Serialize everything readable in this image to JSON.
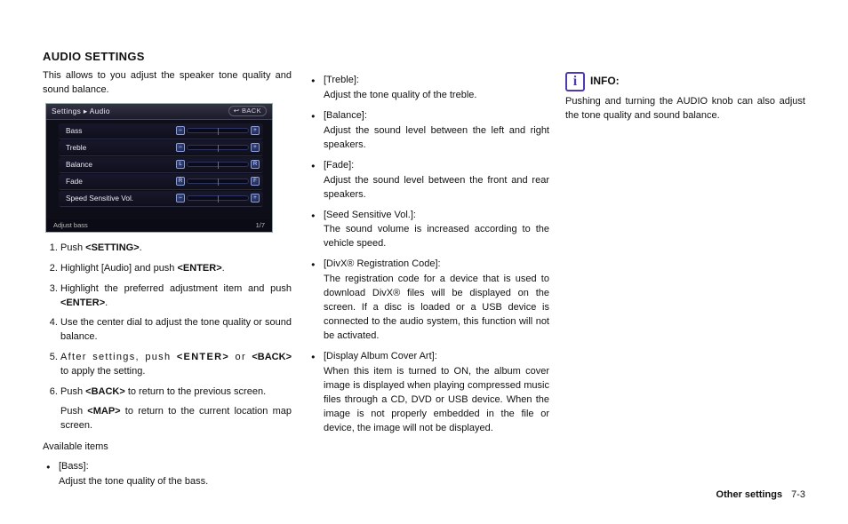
{
  "heading": "AUDIO SETTINGS",
  "intro": "This allows to you adjust the speaker tone quality and sound balance.",
  "screenshot": {
    "breadcrumb": "Settings ▸ Audio",
    "back": "↩ BACK",
    "rows": [
      {
        "label": "Bass",
        "left": "–",
        "right": "+"
      },
      {
        "label": "Treble",
        "left": "–",
        "right": "+"
      },
      {
        "label": "Balance",
        "left": "L",
        "right": "R"
      },
      {
        "label": "Fade",
        "left": "R",
        "right": "F"
      },
      {
        "label": "Speed Sensitive Vol.",
        "left": "–",
        "right": "+"
      }
    ],
    "status": "Adjust bass",
    "page": "1/7"
  },
  "steps": [
    {
      "pre": "Push ",
      "kw": "<SETTING>",
      "post": "."
    },
    {
      "pre": "Highlight [Audio] and push ",
      "kw": "<ENTER>",
      "post": "."
    },
    {
      "pre": "Highlight the preferred adjustment item and push ",
      "kw": "<ENTER>",
      "post": "."
    },
    {
      "pre": "Use the center dial to adjust the tone quality or sound balance.",
      "kw": "",
      "post": ""
    },
    {
      "raw_html": true,
      "text_a": "After settings, push ",
      "kw_a": "<ENTER>",
      "mid": " or ",
      "kw_b": "<BACK>",
      "text_b": " to apply the setting.",
      "wide": true
    },
    {
      "pre": "Push ",
      "kw": "<BACK>",
      "post": " to return to the previous screen.",
      "sub_pre": "Push ",
      "sub_kw": "<MAP>",
      "sub_post": " to return to the current location map screen."
    }
  ],
  "available_label": "Available items",
  "col1_item": {
    "label": "[Bass]:",
    "desc": "Adjust the tone quality of the bass."
  },
  "col2_items": [
    {
      "label": "[Treble]:",
      "desc": "Adjust the tone quality of the treble."
    },
    {
      "label": "[Balance]:",
      "desc": "Adjust the sound level between the left and right speakers."
    },
    {
      "label": "[Fade]:",
      "desc": "Adjust the sound level between the front and rear speakers."
    },
    {
      "label": "[Seed Sensitive Vol.]:",
      "desc": "The sound volume is increased according to the vehicle speed."
    },
    {
      "label": "[DivX® Registration Code]:",
      "desc": "The registration code for a device that is used to download DivX® files will be displayed on the screen. If a disc is loaded or a USB device is connected to the audio system, this function will not be activated."
    },
    {
      "label": "[Display Album Cover Art]:",
      "desc": "When this item is turned to ON, the album cover image is displayed when playing compressed music files through a CD, DVD or USB device. When the image is not properly embedded in the file or device, the image will not be displayed."
    }
  ],
  "info_label": "INFO:",
  "info_text": "Pushing and turning the AUDIO knob can also adjust the tone quality and sound balance.",
  "footer_section": "Other settings",
  "footer_page": "7-3"
}
